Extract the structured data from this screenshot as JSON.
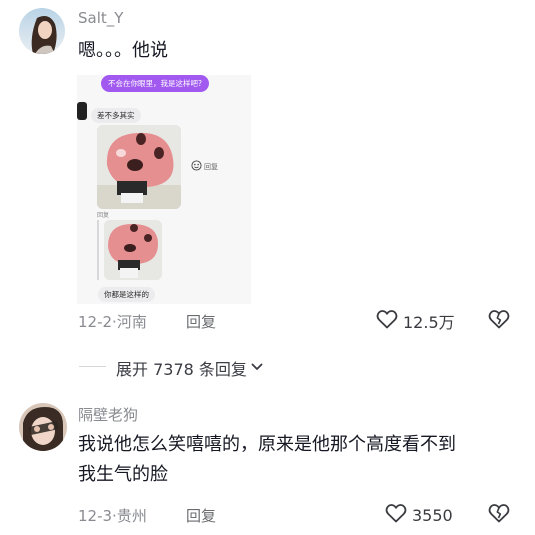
{
  "comments": [
    {
      "username": "Salt_Y",
      "text": "嗯。。。他说",
      "date": "12-2",
      "location": "河南",
      "reply_label": "回复",
      "likes": "12.5万",
      "attached_image": {
        "question_bubble": "不会在你眼里，我是这样吧?",
        "answer_bubble": "差不多其实",
        "inline_reply": "回复",
        "quoted_label": "回复",
        "caption_bubble": "你都是这样的"
      }
    },
    {
      "username": "隔壁老狗",
      "text_line1": "我说他怎么笑嘻嘻的，原来是他那个高度看不到",
      "text_line2": "我生气的脸",
      "date": "12-3",
      "location": "贵州",
      "reply_label": "回复",
      "likes": "3550"
    }
  ],
  "expand": {
    "label": "展开 7378 条回复"
  },
  "icons": [
    "heart-icon",
    "broken-heart-icon",
    "chevron-down-icon",
    "smiley-icon"
  ],
  "colors": {
    "accent_purple": "#a159f0",
    "meta_gray": "#8a8b91"
  }
}
